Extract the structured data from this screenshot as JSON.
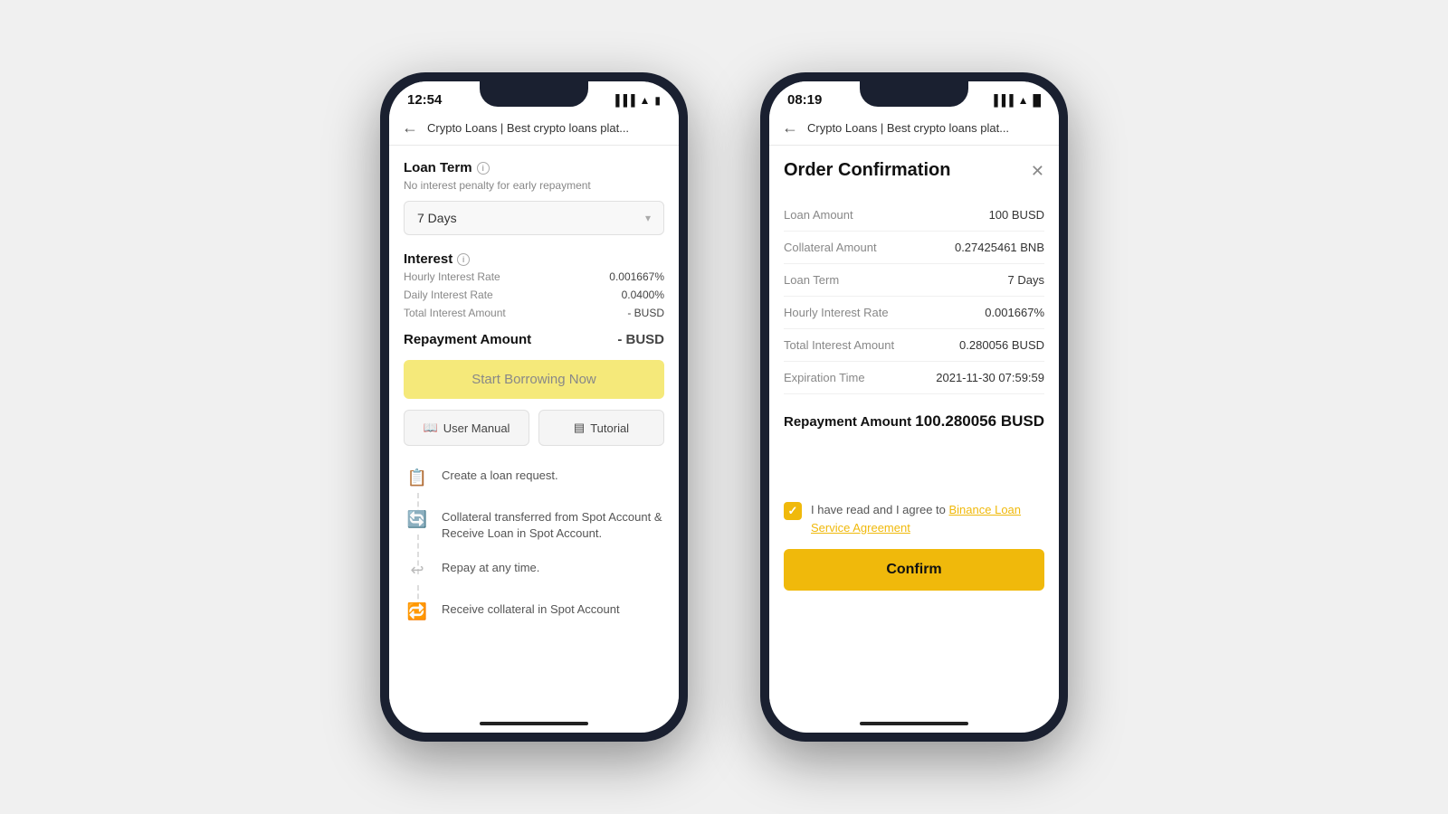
{
  "phone1": {
    "time": "12:54",
    "url": "Crypto Loans | Best crypto loans plat...",
    "loanTerm": {
      "title": "Loan Term",
      "subtitle": "No interest penalty for early repayment",
      "selected": "7 Days"
    },
    "interest": {
      "title": "Interest",
      "rows": [
        {
          "label": "Hourly Interest Rate",
          "value": "0.001667%"
        },
        {
          "label": "Daily Interest Rate",
          "value": "0.0400%"
        },
        {
          "label": "Total Interest Amount",
          "value": "- BUSD"
        }
      ]
    },
    "repayment": {
      "label": "Repayment Amount",
      "value": "- BUSD"
    },
    "borrowBtn": "Start Borrowing Now",
    "userManualBtn": "User Manual",
    "tutorialBtn": "Tutorial",
    "steps": [
      {
        "icon": "📋",
        "text": "Create a loan request."
      },
      {
        "icon": "🔄",
        "text": "Collateral transferred from Spot Account & Receive Loan in Spot Account."
      },
      {
        "icon": "↩",
        "text": "Repay at any time."
      },
      {
        "icon": "🔁",
        "text": "Receive collateral in Spot Account"
      }
    ]
  },
  "phone2": {
    "time": "08:19",
    "url": "Crypto Loans | Best crypto loans plat...",
    "modal": {
      "title": "Order Confirmation",
      "rows": [
        {
          "label": "Loan Amount",
          "value": "100 BUSD"
        },
        {
          "label": "Collateral Amount",
          "value": "0.27425461 BNB"
        },
        {
          "label": "Loan Term",
          "value": "7 Days"
        },
        {
          "label": "Hourly Interest Rate",
          "value": "0.001667%"
        },
        {
          "label": "Total Interest Amount",
          "value": "0.280056 BUSD"
        },
        {
          "label": "Expiration Time",
          "value": "2021-11-30 07:59:59"
        }
      ],
      "repaymentLabel": "Repayment Amount",
      "repaymentValue": "100.280056 BUSD",
      "agreementText": "I have read and I agree to ",
      "agreementLink": "Binance Loan Service Agreement",
      "confirmBtn": "Confirm"
    }
  }
}
